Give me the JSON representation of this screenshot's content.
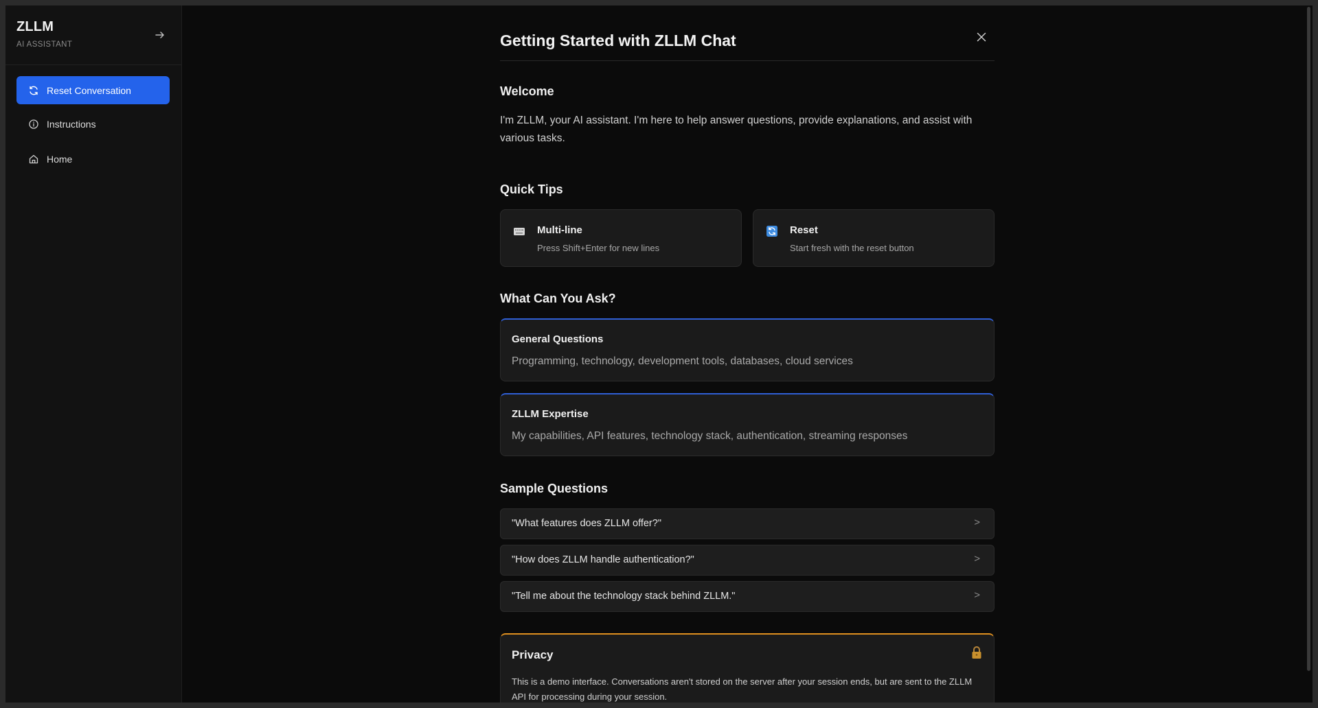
{
  "sidebar": {
    "brand_title": "ZLLM",
    "brand_subtitle": "AI ASSISTANT",
    "items": [
      {
        "label": "Reset Conversation",
        "icon": "refresh-icon",
        "active": true
      },
      {
        "label": "Instructions",
        "icon": "info-icon",
        "active": false
      },
      {
        "label": "Home",
        "icon": "home-icon",
        "active": false
      }
    ]
  },
  "modal": {
    "title": "Getting Started with ZLLM Chat",
    "welcome": {
      "heading": "Welcome",
      "text": "I'm ZLLM, your AI assistant. I'm here to help answer questions, provide explanations, and assist with various tasks."
    },
    "quick_tips": {
      "heading": "Quick Tips",
      "items": [
        {
          "title": "Multi-line",
          "desc": "Press Shift+Enter for new lines",
          "icon": "keyboard-icon"
        },
        {
          "title": "Reset",
          "desc": "Start fresh with the reset button",
          "icon": "reset-icon"
        }
      ]
    },
    "what_can_you_ask": {
      "heading": "What Can You Ask?",
      "items": [
        {
          "title": "General Questions",
          "desc": "Programming, technology, development tools, databases, cloud services"
        },
        {
          "title": "ZLLM Expertise",
          "desc": "My capabilities, API features, technology stack, authentication, streaming responses"
        }
      ]
    },
    "sample_questions": {
      "heading": "Sample Questions",
      "items": [
        {
          "text": "\"What features does ZLLM offer?\"",
          "arrow": ">"
        },
        {
          "text": "\"How does ZLLM handle authentication?\"",
          "arrow": ">"
        },
        {
          "text": "\"Tell me about the technology stack behind ZLLM.\"",
          "arrow": ">"
        }
      ]
    },
    "privacy": {
      "heading": "Privacy",
      "text": "This is a demo interface. Conversations aren't stored on the server after your session ends, but are sent to the ZLLM API for processing during your session.",
      "icon": "lock-icon"
    }
  },
  "colors": {
    "accent": "#2463eb",
    "card_border_blue": "#2f5fd6",
    "privacy_border": "#e0901f",
    "background": "#0b0b0b",
    "sidebar_bg": "#121212"
  }
}
